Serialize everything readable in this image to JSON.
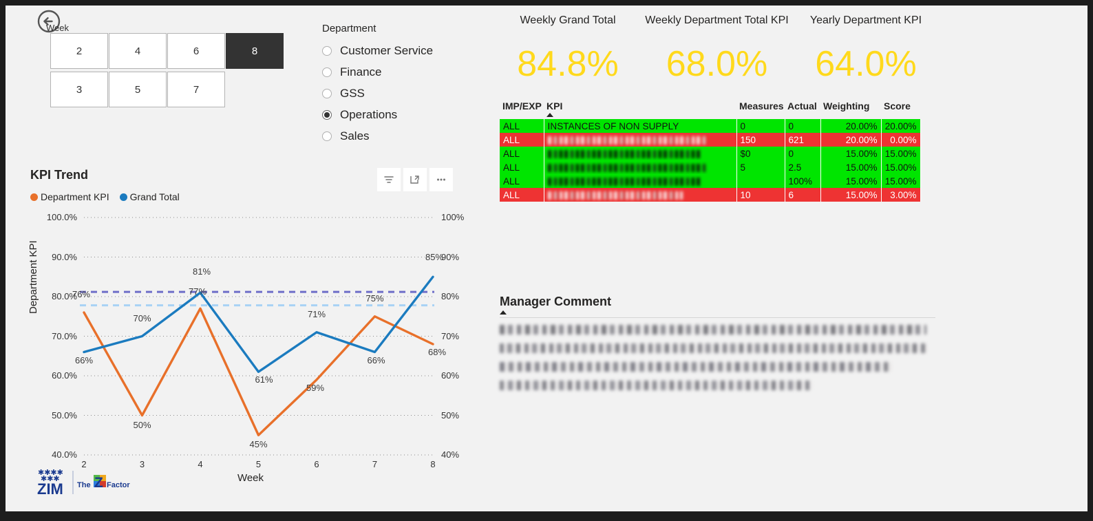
{
  "week_slicer": {
    "label": "Week",
    "back_icon": "back-arrow-icon",
    "weeks_row1": [
      "2",
      "4",
      "6",
      "8"
    ],
    "weeks_row2": [
      "3",
      "5",
      "7"
    ],
    "selected": "8"
  },
  "department_slicer": {
    "title": "Department",
    "items": [
      {
        "label": "Customer Service",
        "selected": false
      },
      {
        "label": "Finance",
        "selected": false
      },
      {
        "label": "GSS",
        "selected": false
      },
      {
        "label": "Operations",
        "selected": true
      },
      {
        "label": "Sales",
        "selected": false
      }
    ]
  },
  "kpi_cards": [
    {
      "title": "Weekly Grand Total",
      "value": "84.8%"
    },
    {
      "title": "Weekly Department Total KPI",
      "value": "68.0%"
    },
    {
      "title": "Yearly Department KPI",
      "value": "64.0%"
    }
  ],
  "kpi_table": {
    "columns": [
      "IMP/EXP",
      "KPI",
      "Measures",
      "Actual",
      "Weighting",
      "Score"
    ],
    "sorted_column": "KPI",
    "sort_direction": "asc",
    "rows": [
      {
        "imp_exp": "ALL",
        "kpi": "INSTANCES OF NON SUPPLY",
        "kpi_redacted": false,
        "measures": "0",
        "actual": "0",
        "weighting": "20.00%",
        "score": "20.00%",
        "status": "good"
      },
      {
        "imp_exp": "ALL",
        "kpi": "",
        "kpi_redacted": true,
        "measures": "150",
        "actual": "621",
        "weighting": "20.00%",
        "score": "0.00%",
        "status": "bad"
      },
      {
        "imp_exp": "ALL",
        "kpi": "",
        "kpi_redacted": true,
        "measures": "$0",
        "actual": "0",
        "weighting": "15.00%",
        "score": "15.00%",
        "status": "good"
      },
      {
        "imp_exp": "ALL",
        "kpi": "",
        "kpi_redacted": true,
        "measures": "5",
        "actual": "2.5",
        "weighting": "15.00%",
        "score": "15.00%",
        "status": "good"
      },
      {
        "imp_exp": "ALL",
        "kpi": "",
        "kpi_redacted": true,
        "measures": "",
        "actual": "100%",
        "weighting": "15.00%",
        "score": "15.00%",
        "status": "good"
      },
      {
        "imp_exp": "ALL",
        "kpi": "",
        "kpi_redacted": true,
        "measures": "10",
        "actual": "6",
        "weighting": "15.00%",
        "score": "3.00%",
        "status": "bad"
      }
    ]
  },
  "kpi_trend": {
    "title": "KPI Trend",
    "toolbar": [
      {
        "icon": "filter-icon"
      },
      {
        "icon": "focus-mode-icon"
      },
      {
        "icon": "more-options-icon"
      }
    ]
  },
  "chart_data": {
    "type": "line",
    "title": "KPI Trend",
    "xlabel": "Week",
    "ylabel": "Department KPI",
    "x": [
      2,
      3,
      4,
      5,
      6,
      7,
      8
    ],
    "ylim": [
      40,
      100
    ],
    "yticks_left": [
      "40.0%",
      "50.0%",
      "60.0%",
      "70.0%",
      "80.0%",
      "90.0%",
      "100.0%"
    ],
    "yticks_right": [
      "40%",
      "50%",
      "60%",
      "70%",
      "80%",
      "90%",
      "100%"
    ],
    "xticks": [
      "2",
      "3",
      "4",
      "5",
      "6",
      "7",
      "8"
    ],
    "grid": true,
    "legend_position": "top-left",
    "series": [
      {
        "name": "Department KPI",
        "color": "#E8702A",
        "values": [
          76,
          50,
          77,
          45,
          59,
          75,
          68
        ],
        "labels": [
          "76%",
          "50%",
          "77%",
          "45%",
          "59%",
          "75%",
          "68%"
        ]
      },
      {
        "name": "Grand Total",
        "color": "#1B7BBF",
        "values": [
          66,
          70,
          81,
          61,
          71,
          66,
          85
        ],
        "labels": [
          "66%",
          "70%",
          "81%",
          "61%",
          "71%",
          "66%",
          "85%"
        ]
      }
    ],
    "reference_lines": [
      {
        "name": "upper-reference-line",
        "value": 81.2,
        "color": "#6e6ec8",
        "style": "dashed"
      },
      {
        "name": "lower-reference-line",
        "value": 77.8,
        "color": "#a8d2f5",
        "style": "dashed"
      }
    ]
  },
  "manager_comment": {
    "title": "Manager Comment",
    "body_redacted": true
  },
  "logo": {
    "brand": "ZIM",
    "tagline_prefix": "The",
    "tagline_mark": "Z",
    "tagline_suffix": "Factor"
  },
  "colors": {
    "accent_yellow": "#ffd91c",
    "status_good": "#00e500",
    "status_bad": "#ee3333",
    "series_department": "#E8702A",
    "series_grand_total": "#1B7BBF",
    "canvas": "#f2f2f2"
  }
}
